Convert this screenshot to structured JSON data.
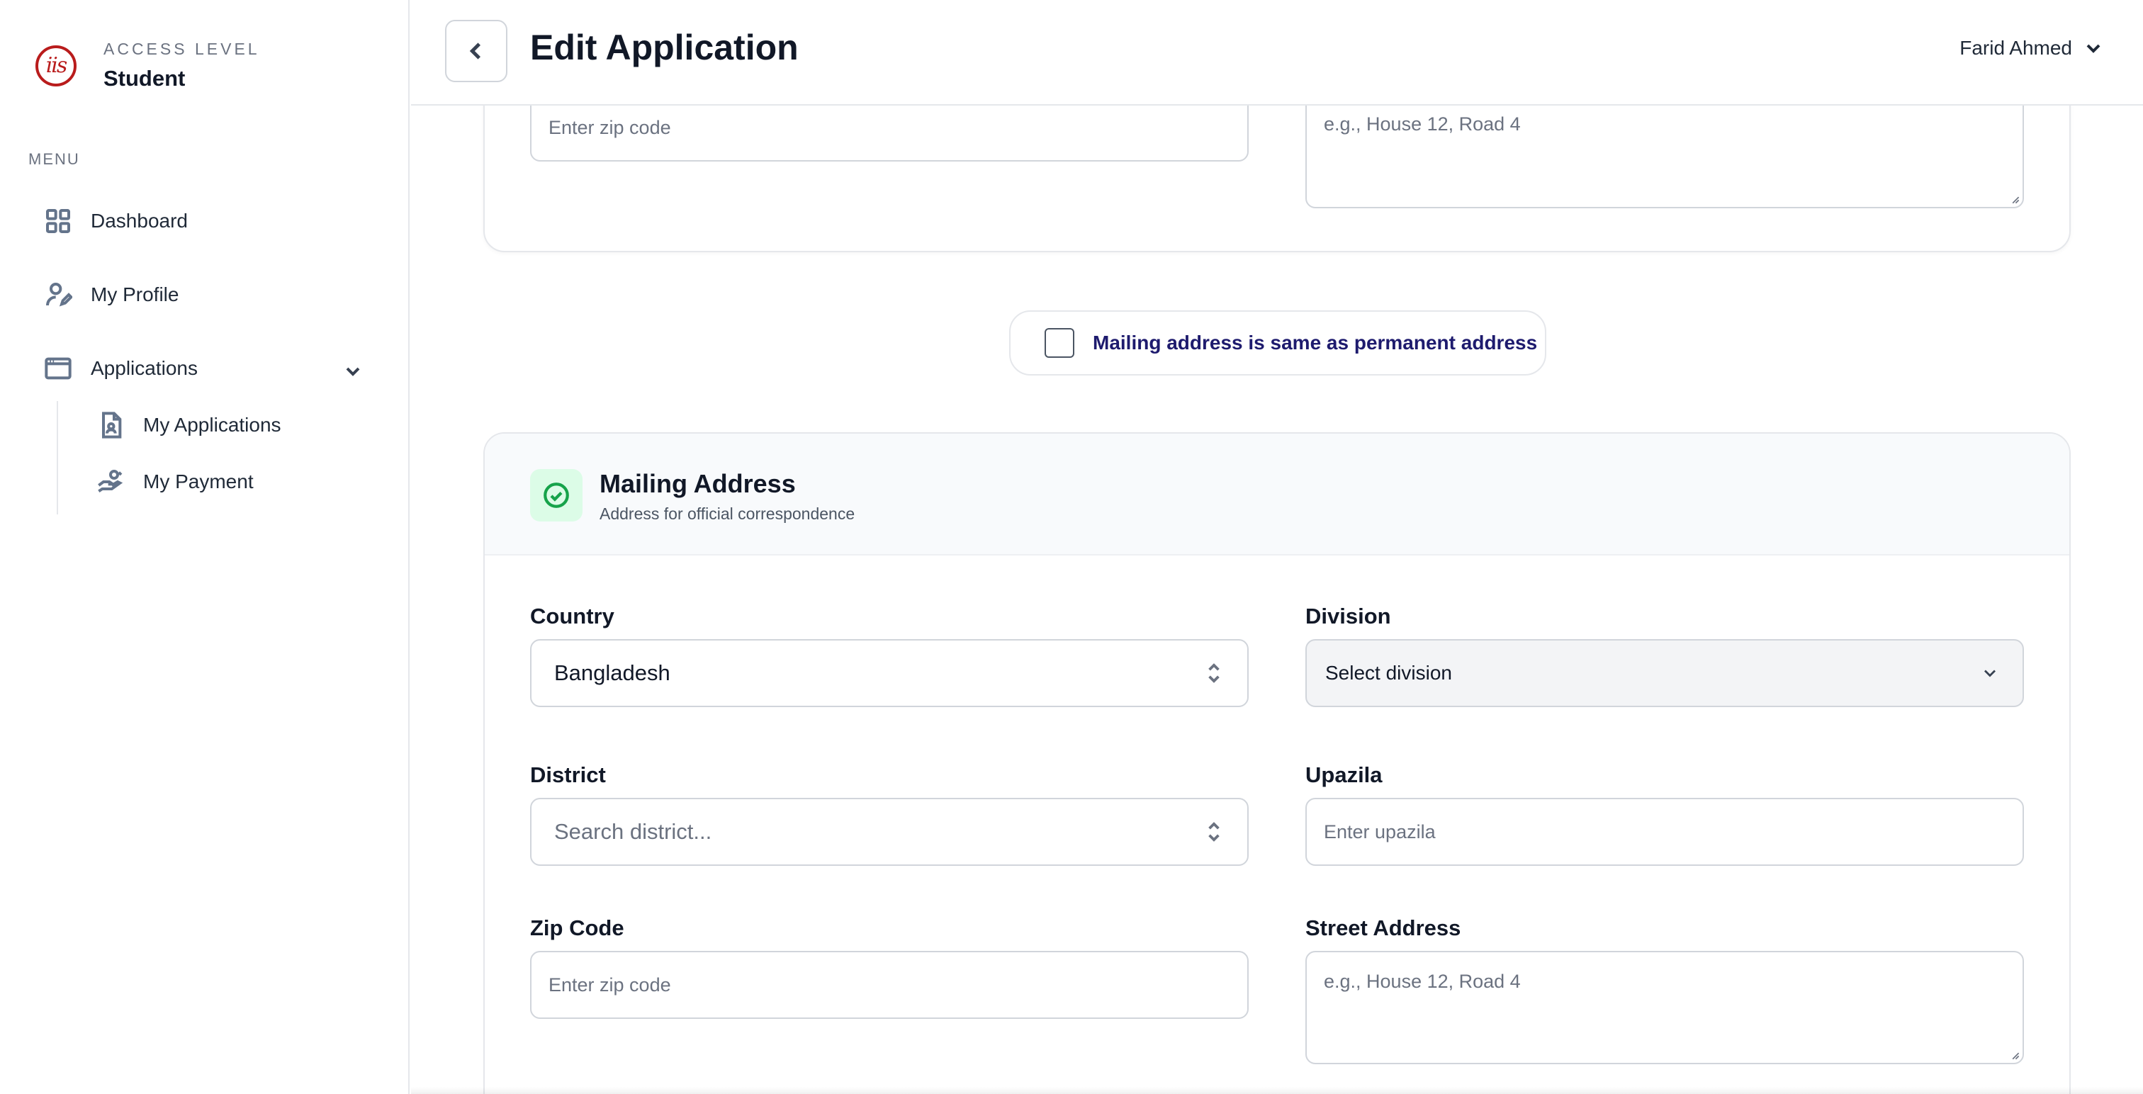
{
  "brand": {
    "logo_text": "iis",
    "access_label": "ACCESS LEVEL",
    "access_value": "Student"
  },
  "sidebar": {
    "menu_label": "MENU",
    "items": [
      {
        "label": "Dashboard",
        "icon": "grid-icon"
      },
      {
        "label": "My Profile",
        "icon": "user-edit-icon"
      },
      {
        "label": "Applications",
        "icon": "browser-window-icon",
        "expanded": true
      },
      {
        "label": "My Applications",
        "icon": "document-user-icon"
      },
      {
        "label": "My Payment",
        "icon": "hand-money-icon"
      }
    ]
  },
  "header": {
    "title": "Edit Application",
    "user_name": "Farid Ahmed"
  },
  "permanent_address": {
    "zip_placeholder": "Enter zip code",
    "street_placeholder": "e.g., House 12, Road 4"
  },
  "same_address": {
    "label": "Mailing address is same as permanent address",
    "checked": false
  },
  "mailing_address": {
    "title": "Mailing Address",
    "subtitle": "Address for official correspondence",
    "country_label": "Country",
    "country_value": "Bangladesh",
    "division_label": "Division",
    "division_value": "Select division",
    "district_label": "District",
    "district_placeholder": "Search district...",
    "upazila_label": "Upazila",
    "upazila_placeholder": "Enter upazila",
    "zip_label": "Zip Code",
    "zip_placeholder": "Enter zip code",
    "street_label": "Street Address",
    "street_placeholder": "e.g., House 12, Road 4"
  }
}
